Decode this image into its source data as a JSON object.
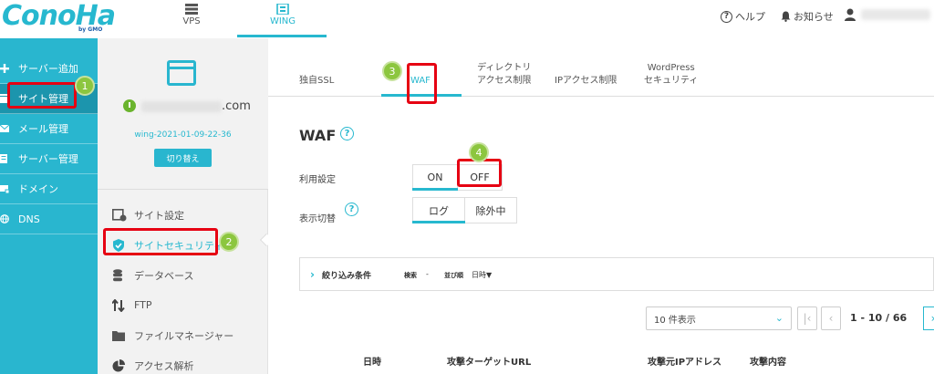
{
  "header": {
    "logo": "ConoHa",
    "logo_sub": "by GMO",
    "nav": [
      {
        "label": "VPS"
      },
      {
        "label": "WING"
      }
    ],
    "help": "ヘルプ",
    "notice": "お知らせ"
  },
  "leftnav": [
    {
      "label": "サーバー追加",
      "icon": "plus-icon"
    },
    {
      "label": "サイト管理",
      "icon": "site-icon"
    },
    {
      "label": "メール管理",
      "icon": "mail-icon"
    },
    {
      "label": "サーバー管理",
      "icon": "server-icon"
    },
    {
      "label": "ドメイン",
      "icon": "domain-icon"
    },
    {
      "label": "DNS",
      "icon": "globe-icon"
    }
  ],
  "site": {
    "domain_suffix": ".com",
    "server_name": "wing-2021-01-09-22-36",
    "switch_label": "切り替え",
    "menu": [
      {
        "label": "サイト設定"
      },
      {
        "label": "サイトセキュリティ"
      },
      {
        "label": "データベース"
      },
      {
        "label": "FTP"
      },
      {
        "label": "ファイルマネージャー"
      },
      {
        "label": "アクセス解析"
      }
    ]
  },
  "tabs": [
    {
      "line1": "独自SSL",
      "line2": ""
    },
    {
      "line1": "WAF",
      "line2": ""
    },
    {
      "line1": "ディレクトリ",
      "line2": "アクセス制限"
    },
    {
      "line1": "IPアクセス制限",
      "line2": ""
    },
    {
      "line1": "WordPress",
      "line2": "セキュリティ"
    }
  ],
  "waf": {
    "title": "WAF",
    "setting_label": "利用設定",
    "on_label": "ON",
    "off_label": "OFF",
    "display_label": "表示切替",
    "log_label": "ログ",
    "exclude_label": "除外中"
  },
  "filter": {
    "title": "絞り込み条件",
    "search_label": "検索",
    "search_value": "-",
    "sort_label": "並び順",
    "sort_value": "日時▼"
  },
  "pagination": {
    "per_page": "10 件表示",
    "range": "1 - 10 / 66"
  },
  "table": {
    "headers": [
      "日時",
      "攻撃ターゲットURL",
      "攻撃元IPアドレス",
      "攻撃内容"
    ]
  },
  "annotations": [
    "1",
    "2",
    "3",
    "4"
  ],
  "colors": {
    "accent": "#27b8cf",
    "nav_bg": "#29b6cf",
    "highlight": "#e60012",
    "badge": "#8cc63f"
  }
}
